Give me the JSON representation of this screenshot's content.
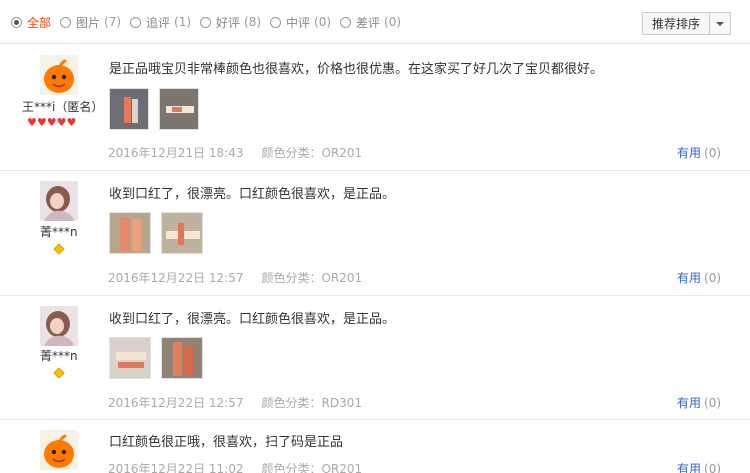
{
  "filters": [
    {
      "label": "全部",
      "count": "",
      "active": true
    },
    {
      "label": "图片",
      "count": "(7)",
      "active": false
    },
    {
      "label": "追评",
      "count": "(1)",
      "active": false
    },
    {
      "label": "好评",
      "count": "(8)",
      "active": false
    },
    {
      "label": "中评",
      "count": "(0)",
      "active": false
    },
    {
      "label": "差评",
      "count": "(0)",
      "active": false
    }
  ],
  "sort": {
    "label": "推荐排序"
  },
  "reviews": [
    {
      "user": "王***i（匿名）",
      "rank": "5-hearts",
      "avatar": "orange-mascot",
      "content": "是正品哦宝贝非常棒颜色也很喜欢，价格也很优惠。在这家买了好几次了宝贝都很好。",
      "date": "2016年12月21日 18:43",
      "sku": "颜色分类：OR201",
      "useful_label": "有用",
      "useful_count": "(0)"
    },
    {
      "user": "菁***n",
      "rank": "1-diamond",
      "avatar": "girl-photo",
      "content": "收到口红了，很漂亮。口红颜色很喜欢，是正品。",
      "date": "2016年12月22日 12:57",
      "sku": "颜色分类：OR201",
      "useful_label": "有用",
      "useful_count": "(0)"
    },
    {
      "user": "菁***n",
      "rank": "1-diamond",
      "avatar": "girl-photo",
      "content": "收到口红了，很漂亮。口红颜色很喜欢，是正品。",
      "date": "2016年12月22日 12:57",
      "sku": "颜色分类：RD301",
      "useful_label": "有用",
      "useful_count": "(0)"
    },
    {
      "user": "",
      "rank": "",
      "avatar": "orange-mascot",
      "content": "口红颜色很正哦，很喜欢，扫了码是正品",
      "date": "2016年12月22日 11:02",
      "sku": "颜色分类：OR201",
      "useful_label": "有用",
      "useful_count": "(0)"
    }
  ],
  "colors": {
    "accent": "#ff4400",
    "link": "#3366cc",
    "heart": "#e33333",
    "diamond": "#f5c400"
  }
}
